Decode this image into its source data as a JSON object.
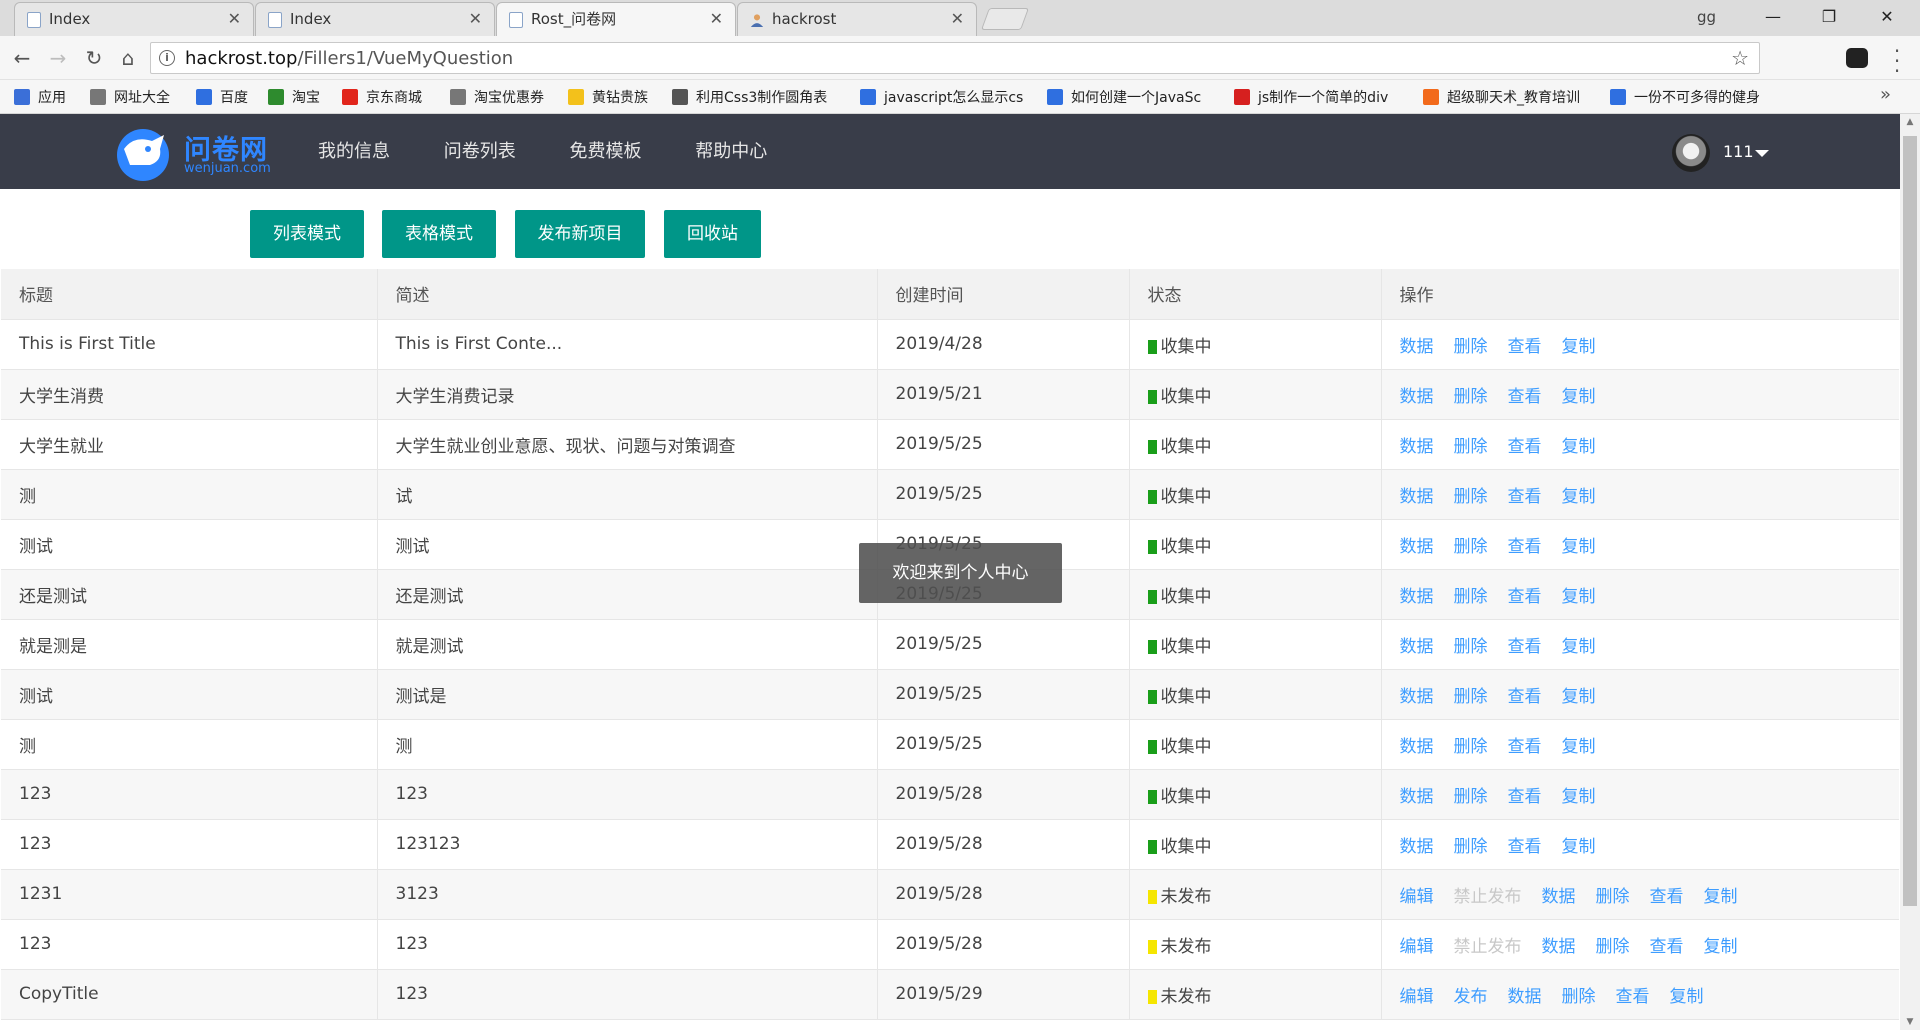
{
  "browser": {
    "tabs": [
      {
        "title": "Index"
      },
      {
        "title": "Index"
      },
      {
        "title": "Rost_问卷网"
      },
      {
        "title": "hackrost"
      }
    ],
    "profile_label": "gg",
    "url": {
      "host": "hackrost.top",
      "path": "/Fillers1/VueMyQuestion"
    },
    "bookmarks": [
      {
        "label": "应用",
        "icon": "apps-grid-icon",
        "color": "#3b6fd8"
      },
      {
        "label": "网址大全",
        "icon": "page-icon",
        "color": "#777777"
      },
      {
        "label": "百度",
        "icon": "baidu-paw-icon",
        "color": "#2f6fe0"
      },
      {
        "label": "淘宝",
        "icon": "taobao-icon",
        "color": "#2e8b2e"
      },
      {
        "label": "京东商城",
        "icon": "jd-icon",
        "color": "#e1251b"
      },
      {
        "label": "淘宝优惠券",
        "icon": "page-icon",
        "color": "#777777"
      },
      {
        "label": "黄钻贵族",
        "icon": "star-icon",
        "color": "#f3c11b"
      },
      {
        "label": "利用Css3制作圆角表",
        "icon": "css-icon",
        "color": "#555555"
      },
      {
        "label": "javascript怎么显示cs",
        "icon": "baidu-paw-icon",
        "color": "#2f6fe0"
      },
      {
        "label": "如何创建一个JavaSc",
        "icon": "baidu-paw-icon",
        "color": "#2f6fe0"
      },
      {
        "label": "js制作一个简单的div",
        "icon": "c-logo-icon",
        "color": "#d6201f"
      },
      {
        "label": "超级聊天术_教育培训",
        "icon": "listen-icon",
        "color": "#f26a1b"
      },
      {
        "label": "一份不可多得的健身",
        "icon": "baidu-paw-icon",
        "color": "#2f6fe0"
      }
    ]
  },
  "site": {
    "brand": {
      "name": "问卷网",
      "sub": "wenjuan.com"
    },
    "nav": [
      "我的信息",
      "问卷列表",
      "免费模板",
      "帮助中心"
    ],
    "user": "111"
  },
  "actions": {
    "list_mode": "列表模式",
    "table_mode": "表格模式",
    "publish_new": "发布新项目",
    "recycle_bin": "回收站"
  },
  "colors": {
    "collecting": "#1a9e1a",
    "unpublished": "#f5e600",
    "link": "#3e9dff",
    "primary_button": "#009688",
    "header_bg": "#393d49"
  },
  "table": {
    "headers": [
      "标题",
      "简述",
      "创建时间",
      "状态",
      "操作"
    ],
    "rows": [
      {
        "title": "This is First Title",
        "desc": "This is First Conte...",
        "date": "2019/4/28",
        "status": "收集中",
        "status_key": "collecting",
        "ops": [
          "数据",
          "删除",
          "查看",
          "复制"
        ]
      },
      {
        "title": "大学生消费",
        "desc": "大学生消费记录",
        "date": "2019/5/21",
        "status": "收集中",
        "status_key": "collecting",
        "ops": [
          "数据",
          "删除",
          "查看",
          "复制"
        ]
      },
      {
        "title": "大学生就业",
        "desc": "大学生就业创业意愿、现状、问题与对策调查",
        "date": "2019/5/25",
        "status": "收集中",
        "status_key": "collecting",
        "ops": [
          "数据",
          "删除",
          "查看",
          "复制"
        ]
      },
      {
        "title": "测",
        "desc": "试",
        "date": "2019/5/25",
        "status": "收集中",
        "status_key": "collecting",
        "ops": [
          "数据",
          "删除",
          "查看",
          "复制"
        ]
      },
      {
        "title": "测试",
        "desc": "测试",
        "date": "2019/5/25",
        "status": "收集中",
        "status_key": "collecting",
        "ops": [
          "数据",
          "删除",
          "查看",
          "复制"
        ]
      },
      {
        "title": "还是测试",
        "desc": "还是测试",
        "date": "2019/5/25",
        "status": "收集中",
        "status_key": "collecting",
        "ops": [
          "数据",
          "删除",
          "查看",
          "复制"
        ]
      },
      {
        "title": "就是测是",
        "desc": "就是测试",
        "date": "2019/5/25",
        "status": "收集中",
        "status_key": "collecting",
        "ops": [
          "数据",
          "删除",
          "查看",
          "复制"
        ]
      },
      {
        "title": "测试",
        "desc": "测试是",
        "date": "2019/5/25",
        "status": "收集中",
        "status_key": "collecting",
        "ops": [
          "数据",
          "删除",
          "查看",
          "复制"
        ]
      },
      {
        "title": "测",
        "desc": "测",
        "date": "2019/5/25",
        "status": "收集中",
        "status_key": "collecting",
        "ops": [
          "数据",
          "删除",
          "查看",
          "复制"
        ]
      },
      {
        "title": "123",
        "desc": "123",
        "date": "2019/5/28",
        "status": "收集中",
        "status_key": "collecting",
        "ops": [
          "数据",
          "删除",
          "查看",
          "复制"
        ]
      },
      {
        "title": "123",
        "desc": "123123",
        "date": "2019/5/28",
        "status": "收集中",
        "status_key": "collecting",
        "ops": [
          "数据",
          "删除",
          "查看",
          "复制"
        ]
      },
      {
        "title": "1231",
        "desc": "3123",
        "date": "2019/5/28",
        "status": "未发布",
        "status_key": "unpublished",
        "ops": [
          "编辑",
          "禁止发布",
          "数据",
          "删除",
          "查看",
          "复制"
        ],
        "disabled_ops": [
          "禁止发布"
        ]
      },
      {
        "title": "123",
        "desc": "123",
        "date": "2019/5/28",
        "status": "未发布",
        "status_key": "unpublished",
        "ops": [
          "编辑",
          "禁止发布",
          "数据",
          "删除",
          "查看",
          "复制"
        ],
        "disabled_ops": [
          "禁止发布"
        ]
      },
      {
        "title": "CopyTitle",
        "desc": "123",
        "date": "2019/5/29",
        "status": "未发布",
        "status_key": "unpublished",
        "ops": [
          "编辑",
          "发布",
          "数据",
          "删除",
          "查看",
          "复制"
        ]
      }
    ]
  },
  "toast": {
    "message": "欢迎来到个人中心"
  }
}
